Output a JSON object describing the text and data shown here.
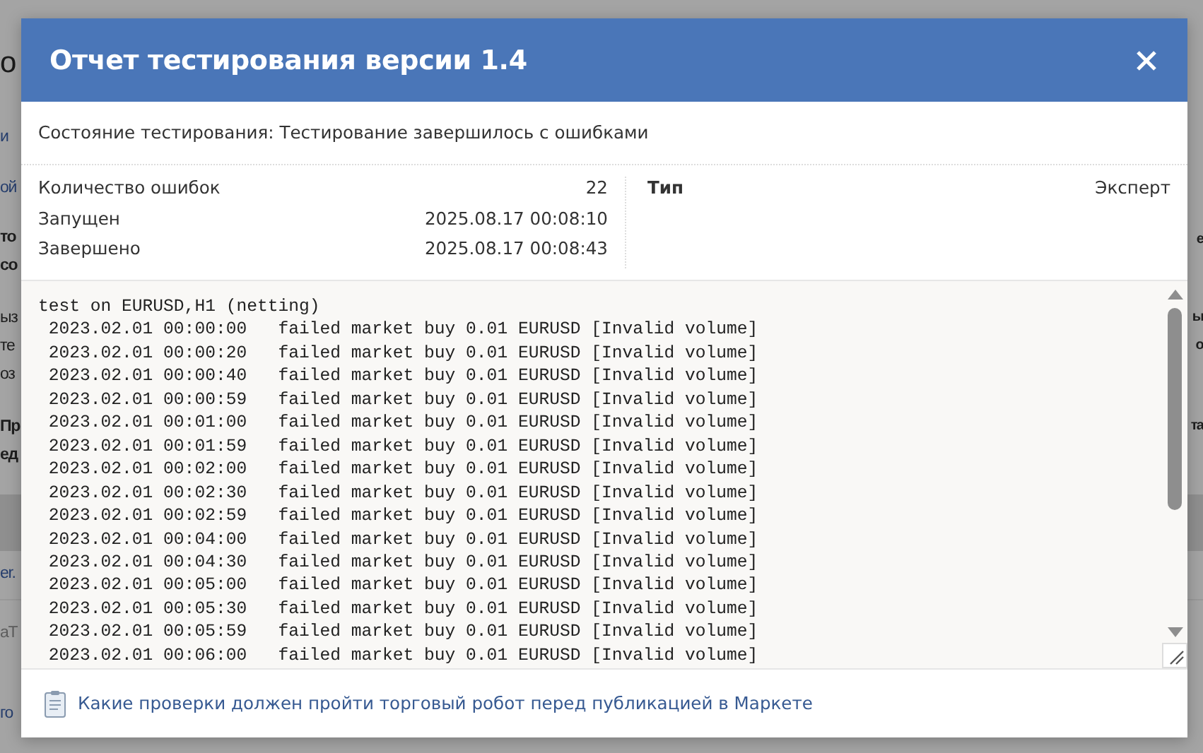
{
  "backdrop": {
    "left_fragments": [
      {
        "text": "о",
        "kind": "heading"
      },
      {
        "text": "и",
        "kind": "link"
      },
      {
        "text": "ой",
        "kind": "link"
      },
      {
        "text": "то",
        "kind": "bold"
      },
      {
        "text": "со",
        "kind": "bold"
      },
      {
        "text": "ыз",
        "kind": "text"
      },
      {
        "text": "те",
        "kind": "text"
      },
      {
        "text": "оз",
        "kind": "text"
      },
      {
        "text": "Пр",
        "kind": "bold"
      },
      {
        "text": "ед",
        "kind": "bold"
      },
      {
        "text": "er.",
        "kind": "link"
      },
      {
        "text": "аТ",
        "kind": "faint"
      },
      {
        "text": "го",
        "kind": "link"
      }
    ],
    "right_fragments": [
      {
        "text": "е",
        "kind": "bold"
      },
      {
        "text": "ы",
        "kind": "bold"
      },
      {
        "text": "о",
        "kind": "bold"
      },
      {
        "text": "та",
        "kind": "bold"
      }
    ]
  },
  "dialog": {
    "title": "Отчет тестирования версии 1.4",
    "status": "Состояние тестирования: Тестирование завершилось с ошибками",
    "info": [
      {
        "label": "Количество ошибок",
        "value": "22"
      },
      {
        "label": "Запущен",
        "value": "2025.08.17 00:08:10"
      },
      {
        "label": "Завершено",
        "value": "2025.08.17 00:08:43"
      }
    ],
    "type": {
      "label": "Тип",
      "value": "Эксперт"
    },
    "log": [
      "test on EURUSD,H1 (netting)",
      " 2023.02.01 00:00:00   failed market buy 0.01 EURUSD [Invalid volume]",
      " 2023.02.01 00:00:20   failed market buy 0.01 EURUSD [Invalid volume]",
      " 2023.02.01 00:00:40   failed market buy 0.01 EURUSD [Invalid volume]",
      " 2023.02.01 00:00:59   failed market buy 0.01 EURUSD [Invalid volume]",
      " 2023.02.01 00:01:00   failed market buy 0.01 EURUSD [Invalid volume]",
      " 2023.02.01 00:01:59   failed market buy 0.01 EURUSD [Invalid volume]",
      " 2023.02.01 00:02:00   failed market buy 0.01 EURUSD [Invalid volume]",
      " 2023.02.01 00:02:30   failed market buy 0.01 EURUSD [Invalid volume]",
      " 2023.02.01 00:02:59   failed market buy 0.01 EURUSD [Invalid volume]",
      " 2023.02.01 00:04:00   failed market buy 0.01 EURUSD [Invalid volume]",
      " 2023.02.01 00:04:30   failed market buy 0.01 EURUSD [Invalid volume]",
      " 2023.02.01 00:05:00   failed market buy 0.01 EURUSD [Invalid volume]",
      " 2023.02.01 00:05:30   failed market buy 0.01 EURUSD [Invalid volume]",
      " 2023.02.01 00:05:59   failed market buy 0.01 EURUSD [Invalid volume]",
      " 2023.02.01 00:06:00   failed market buy 0.01 EURUSD [Invalid volume]"
    ],
    "footer_link": "Какие проверки должен пройти торговый робот перед публикацией в Маркете"
  }
}
